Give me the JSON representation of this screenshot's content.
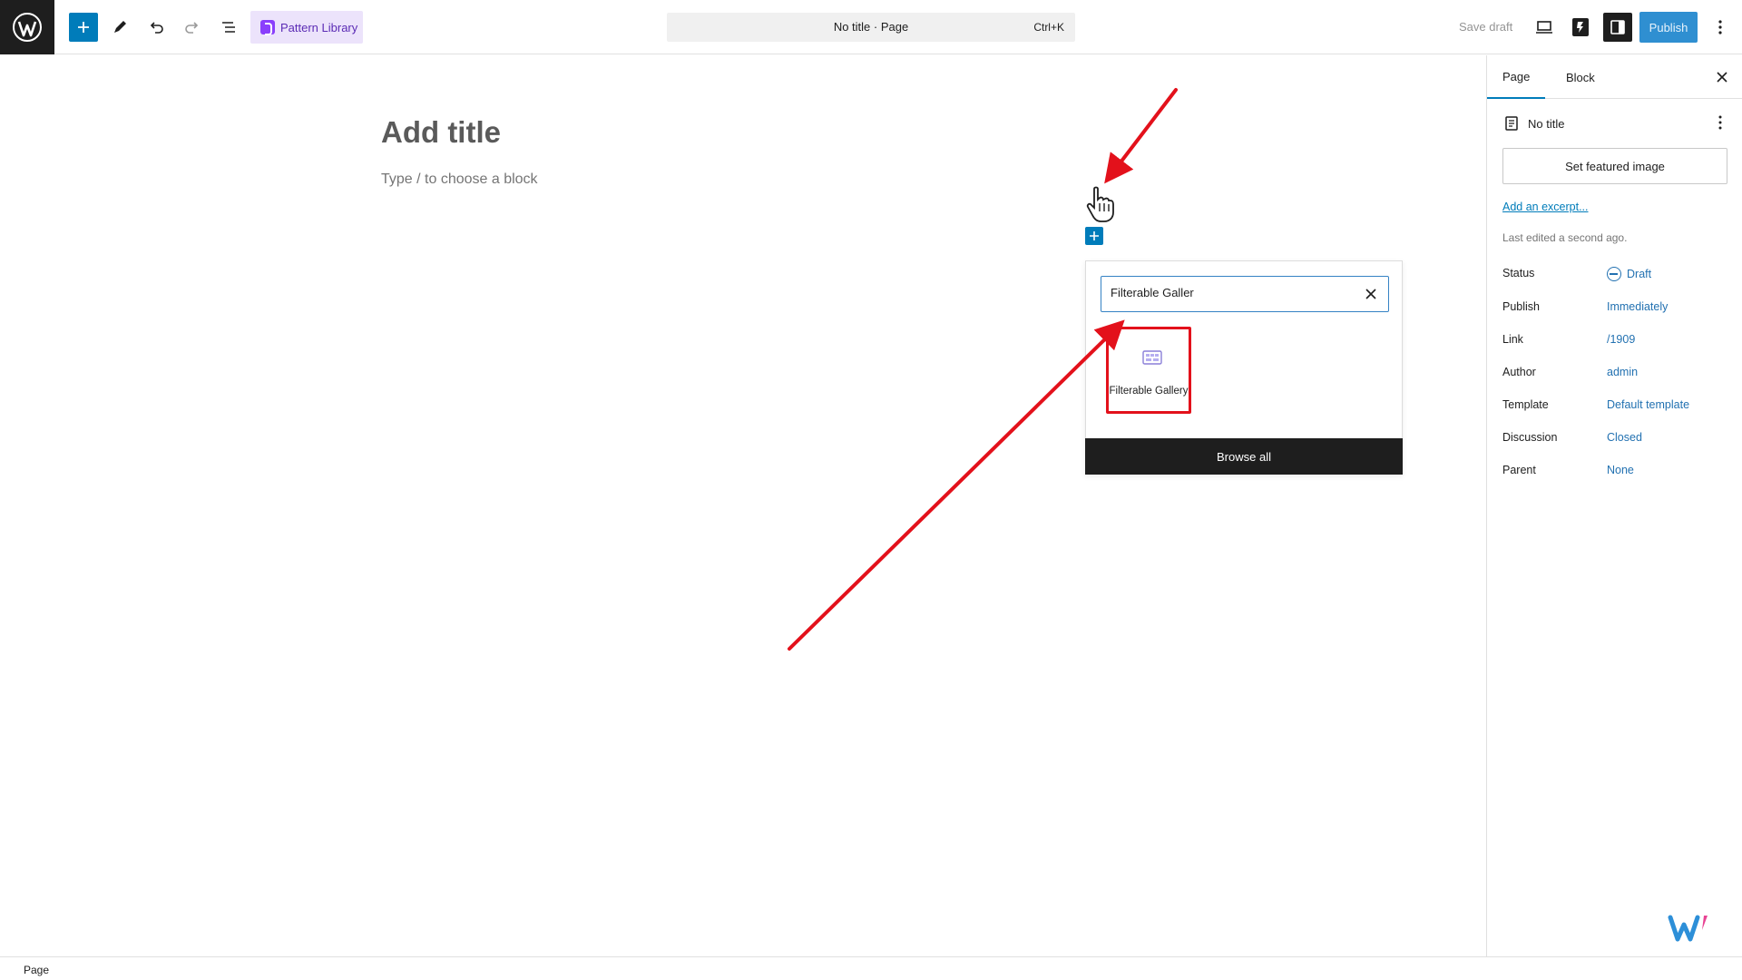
{
  "toolbar": {
    "pattern_library_label": "Pattern Library",
    "document_title": "No title · Page",
    "command_shortcut": "Ctrl+K",
    "save_draft_label": "Save draft",
    "publish_label": "Publish"
  },
  "editor": {
    "title_placeholder": "Add title",
    "block_placeholder": "Type / to choose a block"
  },
  "quick_inserter": {
    "search_value": "Filterable Galler",
    "result_label": "Filterable Gallery",
    "browse_all_label": "Browse all"
  },
  "sidebar": {
    "tabs": [
      {
        "label": "Page",
        "active": true
      },
      {
        "label": "Block",
        "active": false
      }
    ],
    "doc_title": "No title",
    "featured_image_label": "Set featured image",
    "excerpt_link": "Add an excerpt...",
    "last_edited": "Last edited a second ago.",
    "meta": [
      {
        "key": "Status",
        "value": "Draft"
      },
      {
        "key": "Publish",
        "value": "Immediately"
      },
      {
        "key": "Link",
        "value": "/1909"
      },
      {
        "key": "Author",
        "value": "admin"
      },
      {
        "key": "Template",
        "value": "Default template"
      },
      {
        "key": "Discussion",
        "value": "Closed"
      },
      {
        "key": "Parent",
        "value": "None"
      }
    ]
  },
  "footer": {
    "breadcrumb": "Page"
  },
  "colors": {
    "accent": "#007cba",
    "annotation": "#e3111b",
    "pattern_library_bg": "#ece3fb"
  },
  "icons": [
    "wordpress-logo-icon",
    "plus-icon",
    "pencil-icon",
    "undo-icon",
    "redo-icon",
    "list-view-icon",
    "pattern-library-icon",
    "desktop-preview-icon",
    "block-plugin-icon",
    "settings-sidebar-icon",
    "more-vertical-icon",
    "close-icon",
    "page-icon",
    "gallery-block-icon",
    "draft-status-icon",
    "hand-cursor-icon",
    "w-brand-logo"
  ]
}
